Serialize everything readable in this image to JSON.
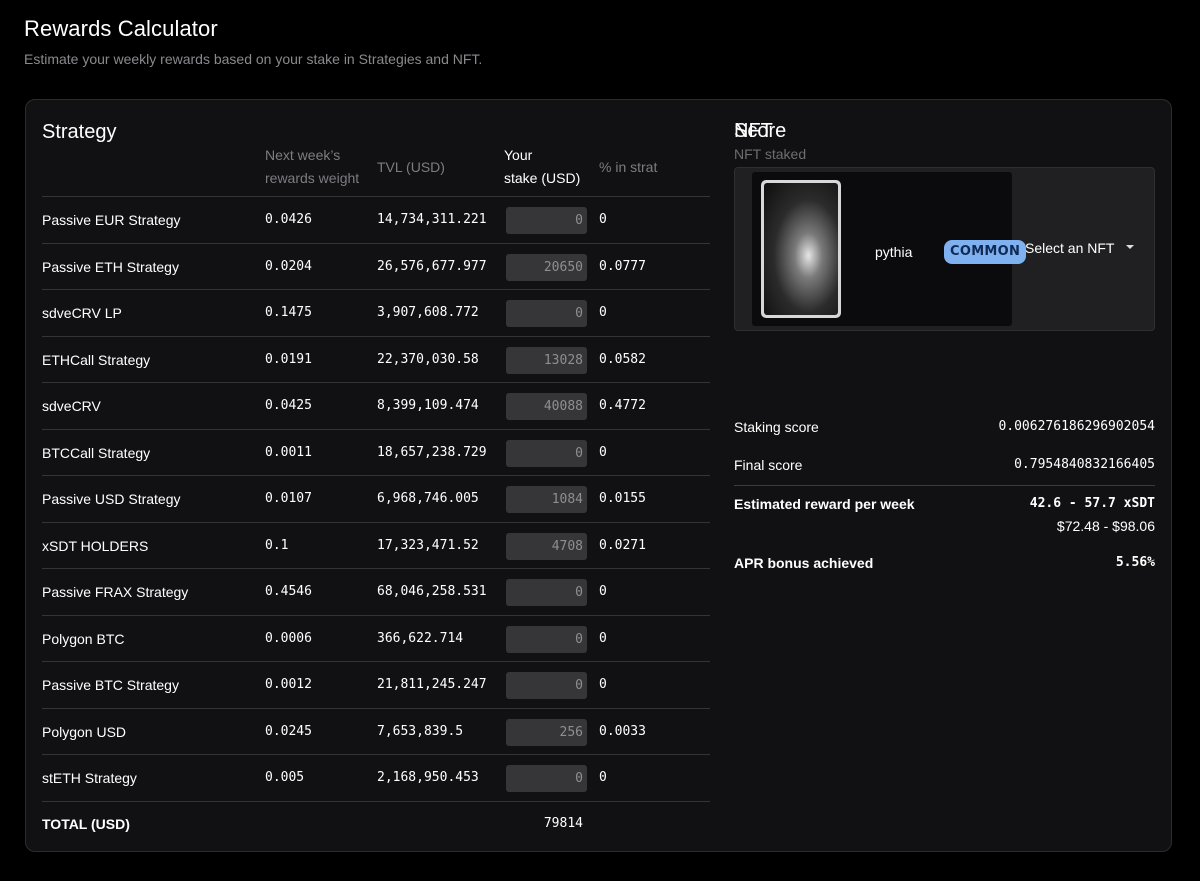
{
  "header": {
    "title": "Rewards Calculator",
    "subtitle": "Estimate your weekly rewards based on your stake in Strategies and NFT."
  },
  "strategy": {
    "title": "Strategy",
    "columns": {
      "weight_line1": "Next week’s",
      "weight_line2": "rewards weight",
      "tvl": "TVL (USD)",
      "stake_line1": "Your",
      "stake_line2": "stake (USD)",
      "pct": "% in strat"
    },
    "rows": [
      {
        "name": "Passive EUR Strategy",
        "weight": "0.0426",
        "tvl": "14,734,311.221",
        "stake": "0",
        "pct": "0"
      },
      {
        "name": "Passive ETH Strategy",
        "weight": "0.0204",
        "tvl": "26,576,677.977",
        "stake": "20650",
        "pct": "0.0777"
      },
      {
        "name": "sdveCRV LP",
        "weight": "0.1475",
        "tvl": "3,907,608.772",
        "stake": "0",
        "pct": "0"
      },
      {
        "name": "ETHCall Strategy",
        "weight": "0.0191",
        "tvl": "22,370,030.58",
        "stake": "13028",
        "pct": "0.0582"
      },
      {
        "name": "sdveCRV",
        "weight": "0.0425",
        "tvl": "8,399,109.474",
        "stake": "40088",
        "pct": "0.4772"
      },
      {
        "name": "BTCCall Strategy",
        "weight": "0.0011",
        "tvl": "18,657,238.729",
        "stake": "0",
        "pct": "0"
      },
      {
        "name": "Passive USD Strategy",
        "weight": "0.0107",
        "tvl": "6,968,746.005",
        "stake": "1084",
        "pct": "0.0155"
      },
      {
        "name": "xSDT HOLDERS",
        "weight": "0.1",
        "tvl": "17,323,471.52",
        "stake": "4708",
        "pct": "0.0271"
      },
      {
        "name": "Passive FRAX Strategy",
        "weight": "0.4546",
        "tvl": "68,046,258.531",
        "stake": "0",
        "pct": "0"
      },
      {
        "name": "Polygon BTC",
        "weight": "0.0006",
        "tvl": "366,622.714",
        "stake": "0",
        "pct": "0"
      },
      {
        "name": "Passive BTC Strategy",
        "weight": "0.0012",
        "tvl": "21,811,245.247",
        "stake": "0",
        "pct": "0"
      },
      {
        "name": "Polygon USD",
        "weight": "0.0245",
        "tvl": "7,653,839.5",
        "stake": "256",
        "pct": "0.0033"
      },
      {
        "name": "stETH Strategy",
        "weight": "0.005",
        "tvl": "2,168,950.453",
        "stake": "0",
        "pct": "0"
      }
    ],
    "total_label": "TOTAL (USD)",
    "total_value": "79814"
  },
  "nft": {
    "title": "NFT",
    "subtitle": "NFT staked",
    "name": "pythia",
    "rarity": "COMMON",
    "select_label": "Select an NFT",
    "card_icon": "nft-card-art"
  },
  "score": {
    "title": "Score",
    "staking_label": "Staking score",
    "staking_value": "0.006276186296902054",
    "final_label": "Final score",
    "final_value": "0.7954840832166405",
    "reward_label": "Estimated reward per week",
    "reward_value": "42.6 - 57.7 xSDT",
    "reward_usd": "$72.48 - $98.06",
    "apr_label": "APR bonus achieved",
    "apr_value": "5.56%"
  },
  "colors": {
    "background": "#000000",
    "card": "#111113",
    "badge": "#7fb0f0"
  }
}
